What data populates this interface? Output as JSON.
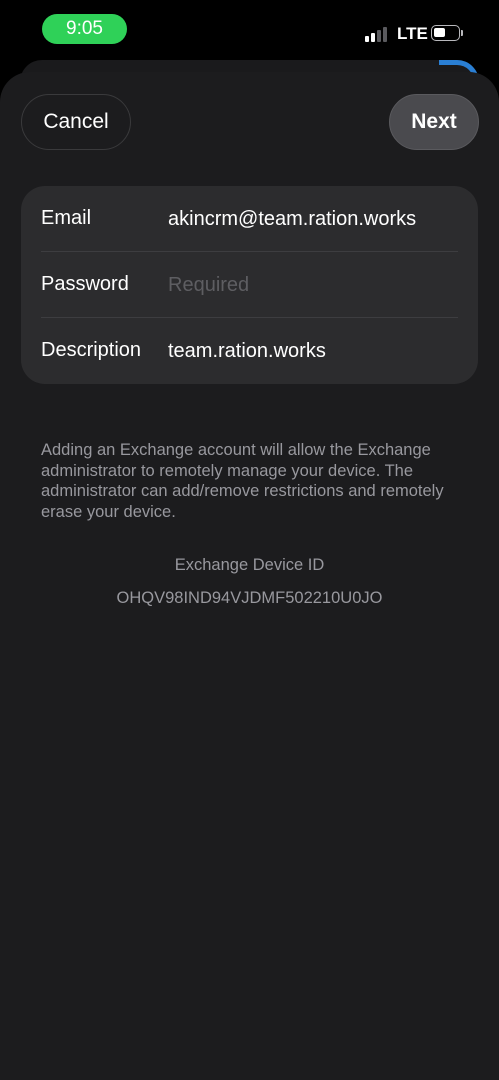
{
  "status_bar": {
    "time": "9:05",
    "network": "LTE",
    "time_pill_color": "#2fd158"
  },
  "nav": {
    "cancel_label": "Cancel",
    "next_label": "Next"
  },
  "form": {
    "email": {
      "label": "Email",
      "value": "akincrm@team.ration.works"
    },
    "password": {
      "label": "Password",
      "placeholder": "Required"
    },
    "description": {
      "label": "Description",
      "value": "team.ration.works"
    }
  },
  "notice": {
    "text": "Adding an Exchange account will allow the Exchange administrator to remotely manage your device. The administrator can add/remove restrictions and remotely erase your device."
  },
  "device": {
    "id_label": "Exchange Device ID",
    "id_value": "OHQV98IND94VJDMF502210U0JO"
  },
  "icons": [
    "signal-icon",
    "battery-icon"
  ],
  "colors": {
    "sheet_background": "#1c1c1e",
    "card_background": "#2c2c2e",
    "secondary_text": "#98989e"
  }
}
